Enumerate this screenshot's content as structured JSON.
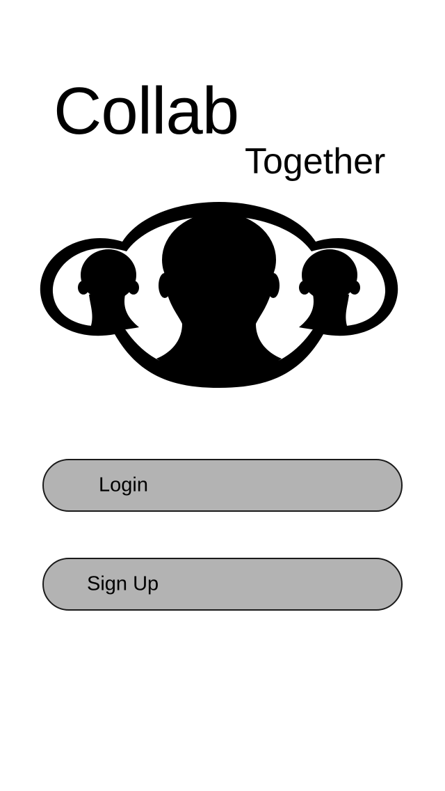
{
  "app": {
    "title": "Collab",
    "subtitle": "Together",
    "logo_icon": "group-people-icon"
  },
  "actions": {
    "login_label": "Login",
    "signup_label": "Sign Up"
  },
  "colors": {
    "background": "#ffffff",
    "button_fill": "#b3b3b3",
    "button_border": "#1a1a1a",
    "text": "#000000"
  }
}
